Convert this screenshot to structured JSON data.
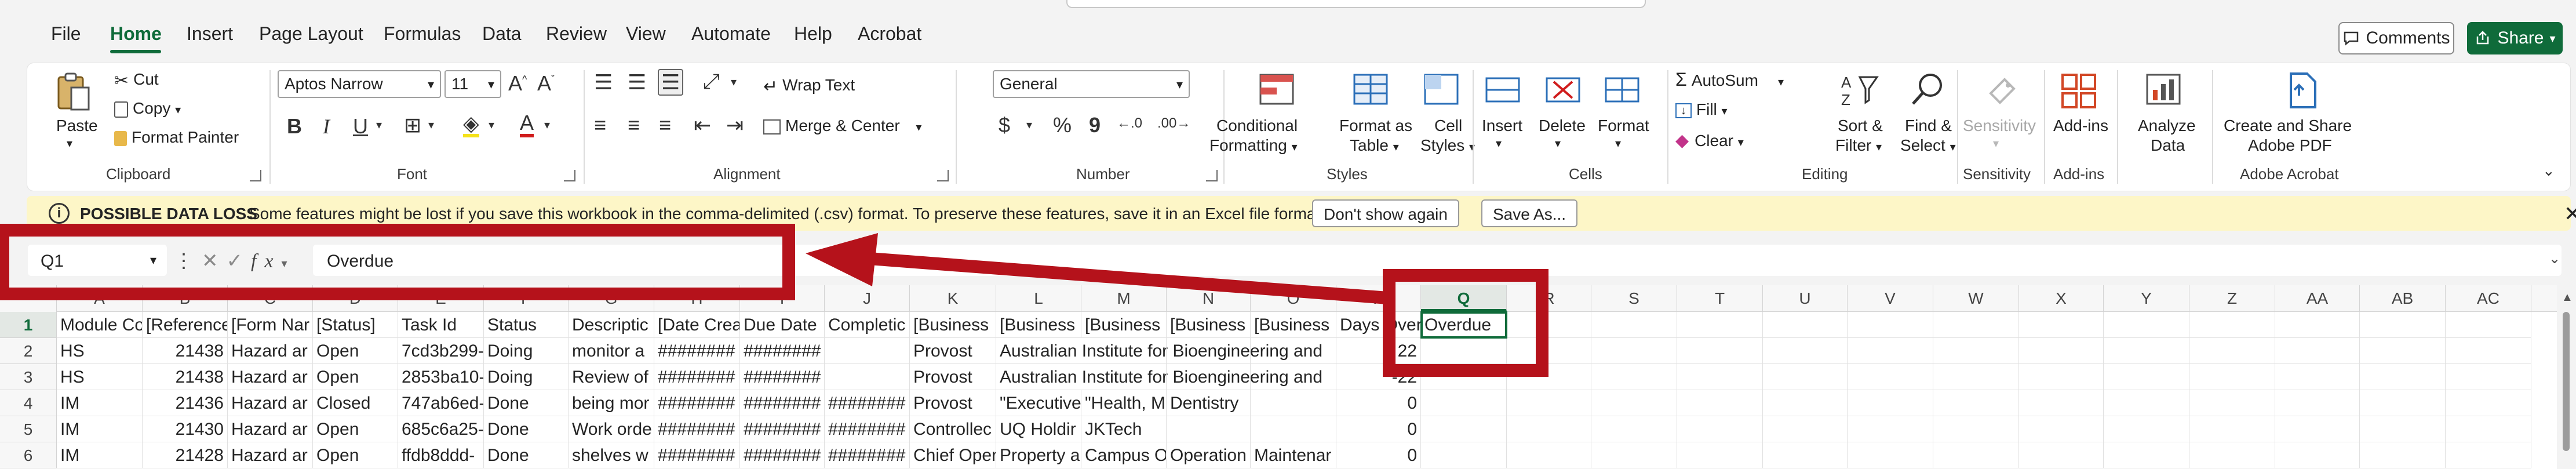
{
  "menu": {
    "items": [
      "File",
      "Home",
      "Insert",
      "Page Layout",
      "Formulas",
      "Data",
      "Review",
      "View",
      "Automate",
      "Help",
      "Acrobat"
    ],
    "active": "Home",
    "comments_label": "Comments",
    "share_label": "Share"
  },
  "ribbon": {
    "clipboard": {
      "paste": "Paste",
      "cut": "Cut",
      "copy": "Copy",
      "format_painter": "Format Painter",
      "label": "Clipboard"
    },
    "font": {
      "name": "Aptos Narrow",
      "size": "11",
      "label": "Font"
    },
    "alignment": {
      "wrap_text": "Wrap Text",
      "merge_center": "Merge & Center",
      "label": "Alignment"
    },
    "number": {
      "format": "General",
      "currency": "$",
      "percent": "%",
      "comma": "9",
      "label": "Number"
    },
    "styles": {
      "conditional_1": "Conditional",
      "conditional_2": "Formatting",
      "format_table_1": "Format as",
      "format_table_2": "Table",
      "cell_styles_1": "Cell",
      "cell_styles_2": "Styles",
      "label": "Styles"
    },
    "cells": {
      "insert": "Insert",
      "delete": "Delete",
      "format": "Format",
      "label": "Cells"
    },
    "editing": {
      "autosum": "AutoSum",
      "fill": "Fill",
      "clear": "Clear",
      "sort_1": "Sort &",
      "sort_2": "Filter",
      "find_1": "Find &",
      "find_2": "Select",
      "label": "Editing"
    },
    "sensitivity": {
      "button": "Sensitivity",
      "label": "Sensitivity"
    },
    "addins": {
      "button": "Add-ins",
      "label": "Add-ins"
    },
    "analyze": {
      "line1": "Analyze",
      "line2": "Data"
    },
    "acrobat": {
      "line1": "Create and Share",
      "line2": "Adobe PDF",
      "label": "Adobe Acrobat"
    }
  },
  "infobar": {
    "title": "POSSIBLE DATA LOSS",
    "message": "Some features might be lost if you save this workbook in the comma-delimited (.csv) format. To preserve these features, save it in an Excel file format.",
    "dont_show": "Don't show again",
    "save_as": "Save As..."
  },
  "formula_bar": {
    "name_box": "Q1",
    "fx": "fx",
    "formula": "Overdue"
  },
  "grid": {
    "columns": [
      "A",
      "B",
      "C",
      "D",
      "E",
      "F",
      "G",
      "H",
      "I",
      "J",
      "K",
      "L",
      "M",
      "N",
      "O",
      "P",
      "Q",
      "R",
      "S",
      "T",
      "U",
      "V",
      "W",
      "X",
      "Y",
      "Z",
      "AA",
      "AB",
      "AC"
    ],
    "selected_column": "Q",
    "row_numbers": [
      "1",
      "2",
      "3",
      "4",
      "5",
      "6"
    ],
    "rows": [
      [
        "Module Co",
        "[Reference",
        "[Form Nar",
        "[Status]",
        "Task Id",
        "Status",
        "Descriptic",
        "[Date Crea",
        "Due Date",
        "Completic",
        "[Business",
        "[Business",
        "[Business",
        "[Business",
        "[Business",
        "Days Over",
        "Overdue"
      ],
      [
        "HS",
        "21438",
        "Hazard ar",
        "Open",
        "7cd3b299-",
        "Doing",
        "monitor a",
        "########",
        "########",
        "",
        "Provost",
        "Australian Institute for Bioengineering and",
        "",
        "",
        "",
        "22",
        ""
      ],
      [
        "HS",
        "21438",
        "Hazard ar",
        "Open",
        "2853ba10-",
        "Doing",
        "Review of",
        "########",
        "########",
        "",
        "Provost",
        "Australian Institute for Bioengineering and",
        "",
        "",
        "",
        "-22",
        ""
      ],
      [
        "IM",
        "21436",
        "Hazard ar",
        "Closed",
        "747ab6ed-",
        "Done",
        "being mor",
        "########",
        "########",
        "########",
        "Provost",
        "\"Executive",
        "\"Health, M",
        "Dentistry",
        "",
        "0",
        ""
      ],
      [
        "IM",
        "21430",
        "Hazard ar",
        "Open",
        "685c6a25-",
        "Done",
        "Work orde",
        "########",
        "########",
        "########",
        "Controllec",
        "UQ Holdir",
        "JKTech",
        "",
        "",
        "0",
        ""
      ],
      [
        "IM",
        "21428",
        "Hazard ar",
        "Open",
        "ffdb8ddd-",
        "Done",
        "shelves w",
        "########",
        "########",
        "########",
        "Chief Oper",
        "Property a",
        "Campus O",
        "Operation",
        "Maintenar",
        "0",
        ""
      ]
    ]
  },
  "colors": {
    "accent": "#0f6b3a",
    "annotation": "#b5121b",
    "infobar_bg": "#fdf6c7"
  }
}
